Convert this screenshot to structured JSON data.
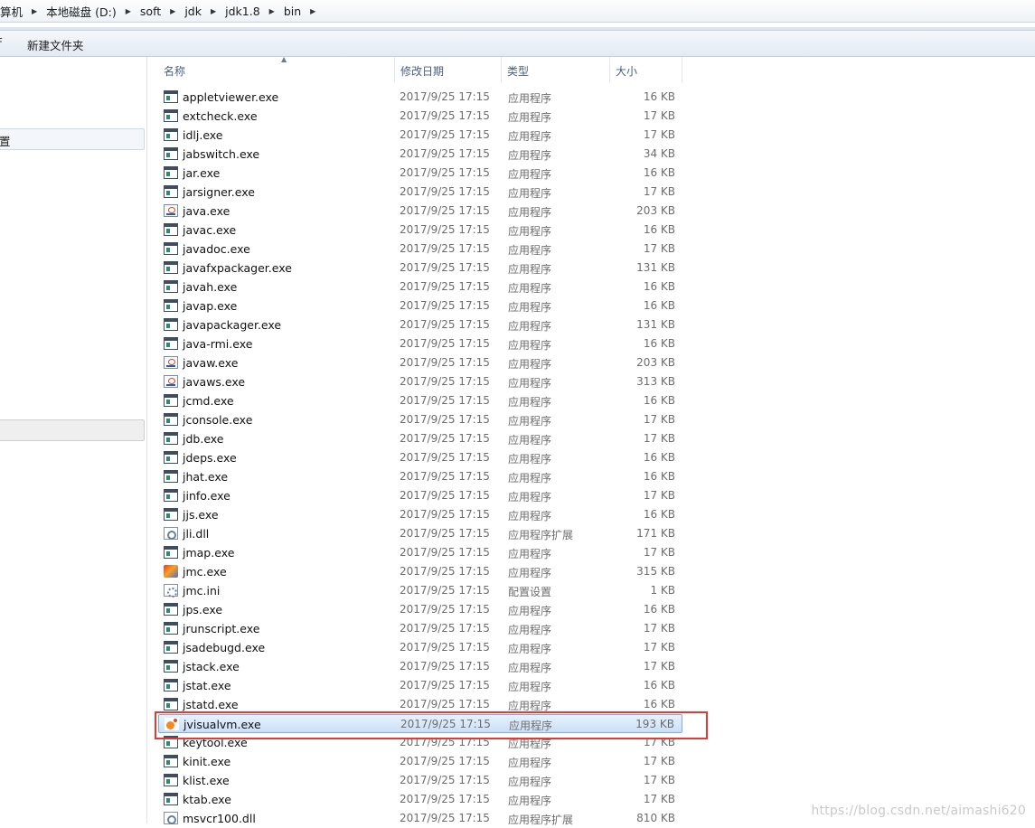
{
  "breadcrumb": {
    "items": [
      "算机",
      "本地磁盘 (D:)",
      "soft",
      "jdk",
      "jdk1.8",
      "bin"
    ],
    "separator_icon": "chevron-right-icon"
  },
  "toolbar": {
    "left_fragment": "F",
    "new_folder_label": "新建文件夹"
  },
  "navigation": {
    "selected_item_label": "置"
  },
  "columns": {
    "name": "名称",
    "date": "修改日期",
    "type": "类型",
    "size": "大小"
  },
  "files": [
    {
      "name": "appletviewer.exe",
      "date": "2017/9/25 17:15",
      "type": "应用程序",
      "size": "16 KB",
      "icon": "exe"
    },
    {
      "name": "extcheck.exe",
      "date": "2017/9/25 17:15",
      "type": "应用程序",
      "size": "17 KB",
      "icon": "exe"
    },
    {
      "name": "idlj.exe",
      "date": "2017/9/25 17:15",
      "type": "应用程序",
      "size": "17 KB",
      "icon": "exe"
    },
    {
      "name": "jabswitch.exe",
      "date": "2017/9/25 17:15",
      "type": "应用程序",
      "size": "34 KB",
      "icon": "exe"
    },
    {
      "name": "jar.exe",
      "date": "2017/9/25 17:15",
      "type": "应用程序",
      "size": "16 KB",
      "icon": "exe"
    },
    {
      "name": "jarsigner.exe",
      "date": "2017/9/25 17:15",
      "type": "应用程序",
      "size": "17 KB",
      "icon": "exe"
    },
    {
      "name": "java.exe",
      "date": "2017/9/25 17:15",
      "type": "应用程序",
      "size": "203 KB",
      "icon": "java"
    },
    {
      "name": "javac.exe",
      "date": "2017/9/25 17:15",
      "type": "应用程序",
      "size": "16 KB",
      "icon": "exe"
    },
    {
      "name": "javadoc.exe",
      "date": "2017/9/25 17:15",
      "type": "应用程序",
      "size": "17 KB",
      "icon": "exe"
    },
    {
      "name": "javafxpackager.exe",
      "date": "2017/9/25 17:15",
      "type": "应用程序",
      "size": "131 KB",
      "icon": "exe"
    },
    {
      "name": "javah.exe",
      "date": "2017/9/25 17:15",
      "type": "应用程序",
      "size": "16 KB",
      "icon": "exe"
    },
    {
      "name": "javap.exe",
      "date": "2017/9/25 17:15",
      "type": "应用程序",
      "size": "16 KB",
      "icon": "exe"
    },
    {
      "name": "javapackager.exe",
      "date": "2017/9/25 17:15",
      "type": "应用程序",
      "size": "131 KB",
      "icon": "exe"
    },
    {
      "name": "java-rmi.exe",
      "date": "2017/9/25 17:15",
      "type": "应用程序",
      "size": "16 KB",
      "icon": "exe"
    },
    {
      "name": "javaw.exe",
      "date": "2017/9/25 17:15",
      "type": "应用程序",
      "size": "203 KB",
      "icon": "java"
    },
    {
      "name": "javaws.exe",
      "date": "2017/9/25 17:15",
      "type": "应用程序",
      "size": "313 KB",
      "icon": "java"
    },
    {
      "name": "jcmd.exe",
      "date": "2017/9/25 17:15",
      "type": "应用程序",
      "size": "16 KB",
      "icon": "exe"
    },
    {
      "name": "jconsole.exe",
      "date": "2017/9/25 17:15",
      "type": "应用程序",
      "size": "17 KB",
      "icon": "exe"
    },
    {
      "name": "jdb.exe",
      "date": "2017/9/25 17:15",
      "type": "应用程序",
      "size": "17 KB",
      "icon": "exe"
    },
    {
      "name": "jdeps.exe",
      "date": "2017/9/25 17:15",
      "type": "应用程序",
      "size": "16 KB",
      "icon": "exe"
    },
    {
      "name": "jhat.exe",
      "date": "2017/9/25 17:15",
      "type": "应用程序",
      "size": "16 KB",
      "icon": "exe"
    },
    {
      "name": "jinfo.exe",
      "date": "2017/9/25 17:15",
      "type": "应用程序",
      "size": "17 KB",
      "icon": "exe"
    },
    {
      "name": "jjs.exe",
      "date": "2017/9/25 17:15",
      "type": "应用程序",
      "size": "16 KB",
      "icon": "exe"
    },
    {
      "name": "jli.dll",
      "date": "2017/9/25 17:15",
      "type": "应用程序扩展",
      "size": "171 KB",
      "icon": "dll"
    },
    {
      "name": "jmap.exe",
      "date": "2017/9/25 17:15",
      "type": "应用程序",
      "size": "17 KB",
      "icon": "exe"
    },
    {
      "name": "jmc.exe",
      "date": "2017/9/25 17:15",
      "type": "应用程序",
      "size": "315 KB",
      "icon": "jmc"
    },
    {
      "name": "jmc.ini",
      "date": "2017/9/25 17:15",
      "type": "配置设置",
      "size": "1 KB",
      "icon": "ini"
    },
    {
      "name": "jps.exe",
      "date": "2017/9/25 17:15",
      "type": "应用程序",
      "size": "16 KB",
      "icon": "exe"
    },
    {
      "name": "jrunscript.exe",
      "date": "2017/9/25 17:15",
      "type": "应用程序",
      "size": "17 KB",
      "icon": "exe"
    },
    {
      "name": "jsadebugd.exe",
      "date": "2017/9/25 17:15",
      "type": "应用程序",
      "size": "17 KB",
      "icon": "exe"
    },
    {
      "name": "jstack.exe",
      "date": "2017/9/25 17:15",
      "type": "应用程序",
      "size": "17 KB",
      "icon": "exe"
    },
    {
      "name": "jstat.exe",
      "date": "2017/9/25 17:15",
      "type": "应用程序",
      "size": "16 KB",
      "icon": "exe"
    },
    {
      "name": "jstatd.exe",
      "date": "2017/9/25 17:15",
      "type": "应用程序",
      "size": "16 KB",
      "icon": "exe"
    },
    {
      "name": "jvisualvm.exe",
      "date": "2017/9/25 17:15",
      "type": "应用程序",
      "size": "193 KB",
      "icon": "visualvm",
      "selected": true
    },
    {
      "name": "keytool.exe",
      "date": "2017/9/25 17:15",
      "type": "应用程序",
      "size": "17 KB",
      "icon": "exe"
    },
    {
      "name": "kinit.exe",
      "date": "2017/9/25 17:15",
      "type": "应用程序",
      "size": "17 KB",
      "icon": "exe"
    },
    {
      "name": "klist.exe",
      "date": "2017/9/25 17:15",
      "type": "应用程序",
      "size": "17 KB",
      "icon": "exe"
    },
    {
      "name": "ktab.exe",
      "date": "2017/9/25 17:15",
      "type": "应用程序",
      "size": "17 KB",
      "icon": "exe"
    },
    {
      "name": "msvcr100.dll",
      "date": "2017/9/25 17:15",
      "type": "应用程序扩展",
      "size": "810 KB",
      "icon": "dll"
    }
  ],
  "highlight_color": "#e53935",
  "selection_color": "#c9e0f7",
  "watermark": "https://blog.csdn.net/aimashi620"
}
